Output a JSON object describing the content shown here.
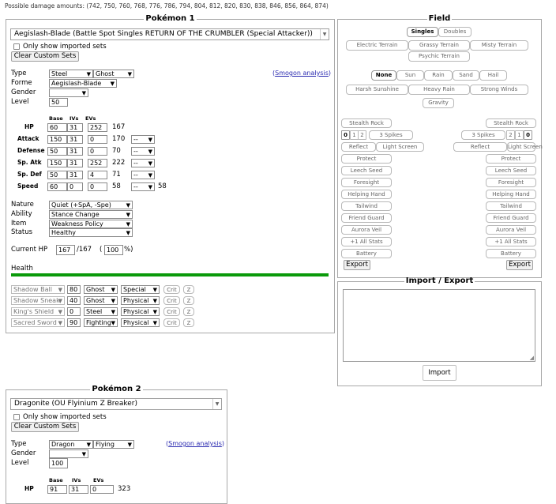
{
  "damage_text": "Possible damage amounts: (742, 750, 760, 768, 776, 786, 794, 804, 812, 820, 830, 838, 846, 856, 864, 874)",
  "p1": {
    "legend": "Pokémon 1",
    "set": "Aegislash-Blade (Battle Spot Singles RETURN OF THE CRUMBLER (Special Attacker))",
    "only_imported": "Only show imported sets",
    "clear_btn": "Clear Custom Sets",
    "type_label": "Type",
    "type1": "Steel",
    "type2": "Ghost",
    "forme_label": "Forme",
    "forme": "Aegislash-Blade",
    "gender_label": "Gender",
    "gender": "",
    "level_label": "Level",
    "level": "50",
    "smogon": "Smogon analysis",
    "col_base": "Base",
    "col_ivs": "IVs",
    "col_evs": "EVs",
    "stats": [
      {
        "label": "HP",
        "base": "60",
        "iv": "31",
        "ev": "252",
        "total": "167",
        "boost": ""
      },
      {
        "label": "Attack",
        "base": "150",
        "iv": "31",
        "ev": "0",
        "total": "170",
        "boost": "--"
      },
      {
        "label": "Defense",
        "base": "50",
        "iv": "31",
        "ev": "0",
        "total": "70",
        "boost": "--"
      },
      {
        "label": "Sp. Atk",
        "base": "150",
        "iv": "31",
        "ev": "252",
        "total": "222",
        "boost": "--"
      },
      {
        "label": "Sp. Def",
        "base": "50",
        "iv": "31",
        "ev": "4",
        "total": "71",
        "boost": "--"
      },
      {
        "label": "Speed",
        "base": "60",
        "iv": "0",
        "ev": "0",
        "total": "58",
        "boost": "--",
        "final": "58"
      }
    ],
    "nature_label": "Nature",
    "nature": "Quiet (+SpA, -Spe)",
    "ability_label": "Ability",
    "ability": "Stance Change",
    "item_label": "Item",
    "item": "Weakness Policy",
    "status_label": "Status",
    "status": "Healthy",
    "curhp_label": "Current HP",
    "curhp": "167",
    "maxhp": "/167",
    "pct_open": "(",
    "pct": "100",
    "pct_close": "%)",
    "health_label": "Health",
    "health_fraction": 1.0,
    "moves": [
      {
        "name": "Shadow Ball",
        "bp": "80",
        "type": "Ghost",
        "cat": "Special"
      },
      {
        "name": "Shadow Sneak",
        "bp": "40",
        "type": "Ghost",
        "cat": "Physical"
      },
      {
        "name": "King's Shield",
        "bp": "0",
        "type": "Steel",
        "cat": "Physical"
      },
      {
        "name": "Sacred Sword",
        "bp": "90",
        "type": "Fighting",
        "cat": "Physical"
      }
    ],
    "crit": "Crit",
    "z": "Z"
  },
  "field": {
    "legend": "Field",
    "formats": [
      "Singles",
      "Doubles"
    ],
    "terrains": [
      "Electric Terrain",
      "Grassy Terrain",
      "Misty Terrain",
      "Psychic Terrain"
    ],
    "weathers": [
      "None",
      "Sun",
      "Rain",
      "Sand",
      "Hail"
    ],
    "weathers2": [
      "Harsh Sunshine",
      "Heavy Rain",
      "Strong Winds"
    ],
    "gravity": "Gravity",
    "side_options": [
      "Stealth Rock",
      "Reflect",
      "Light Screen",
      "Protect",
      "Leech Seed",
      "Foresight",
      "Helping Hand",
      "Tailwind",
      "Friend Guard",
      "Aurora Veil",
      "+1 All Stats",
      "Battery"
    ],
    "spikes": [
      "0",
      "1",
      "2",
      "3 Spikes"
    ],
    "export": "Export"
  },
  "ie": {
    "legend": "Import / Export",
    "import": "Import"
  },
  "p2": {
    "legend": "Pokémon 2",
    "set": "Dragonite (OU Flyinium Z Breaker)",
    "only_imported": "Only show imported sets",
    "clear_btn": "Clear Custom Sets",
    "type_label": "Type",
    "type1": "Dragon",
    "type2": "Flying",
    "gender_label": "Gender",
    "gender": "",
    "level_label": "Level",
    "level": "100",
    "smogon": "Smogon analysis",
    "col_base": "Base",
    "col_ivs": "IVs",
    "col_evs": "EVs",
    "hp_label": "HP",
    "hp_base": "91",
    "hp_iv": "31",
    "hp_ev": "0",
    "hp_total": "323"
  }
}
